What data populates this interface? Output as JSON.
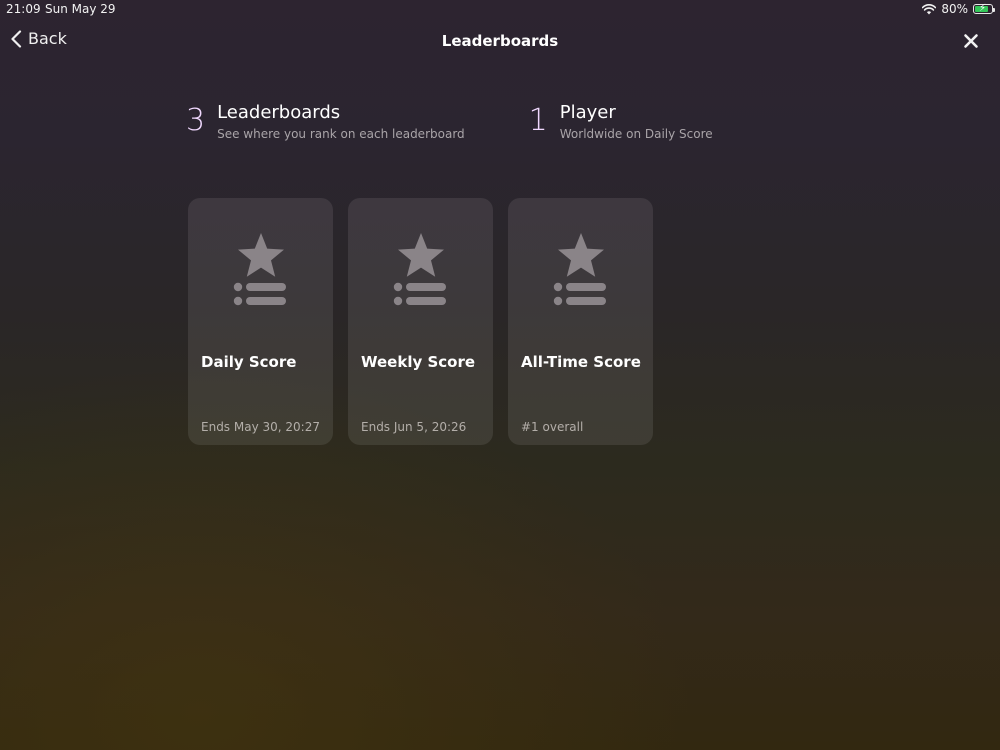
{
  "status_bar": {
    "time": "21:09",
    "date": "Sun May 29",
    "battery": "80%",
    "battery_level": 0.8
  },
  "nav": {
    "back_label": "Back",
    "title": "Leaderboards"
  },
  "summary": {
    "leaderboards": {
      "count": "3",
      "heading": "Leaderboards",
      "sub": "See where you rank on each leaderboard"
    },
    "players": {
      "count": "1",
      "heading": "Player",
      "sub": "Worldwide on Daily Score"
    }
  },
  "cards": [
    {
      "title": "Daily Score",
      "detail": "Ends May 30, 20:27",
      "icon": "leaderboard-star-list-icon"
    },
    {
      "title": "Weekly Score",
      "detail": "Ends Jun 5, 20:26",
      "icon": "leaderboard-star-list-icon"
    },
    {
      "title": "All-Time Score",
      "detail": "#1 overall",
      "icon": "leaderboard-star-list-icon"
    }
  ],
  "colors": {
    "accent_number": "#f1d9ff",
    "battery_green": "#34c759",
    "icon_gray": "#8a8488"
  }
}
